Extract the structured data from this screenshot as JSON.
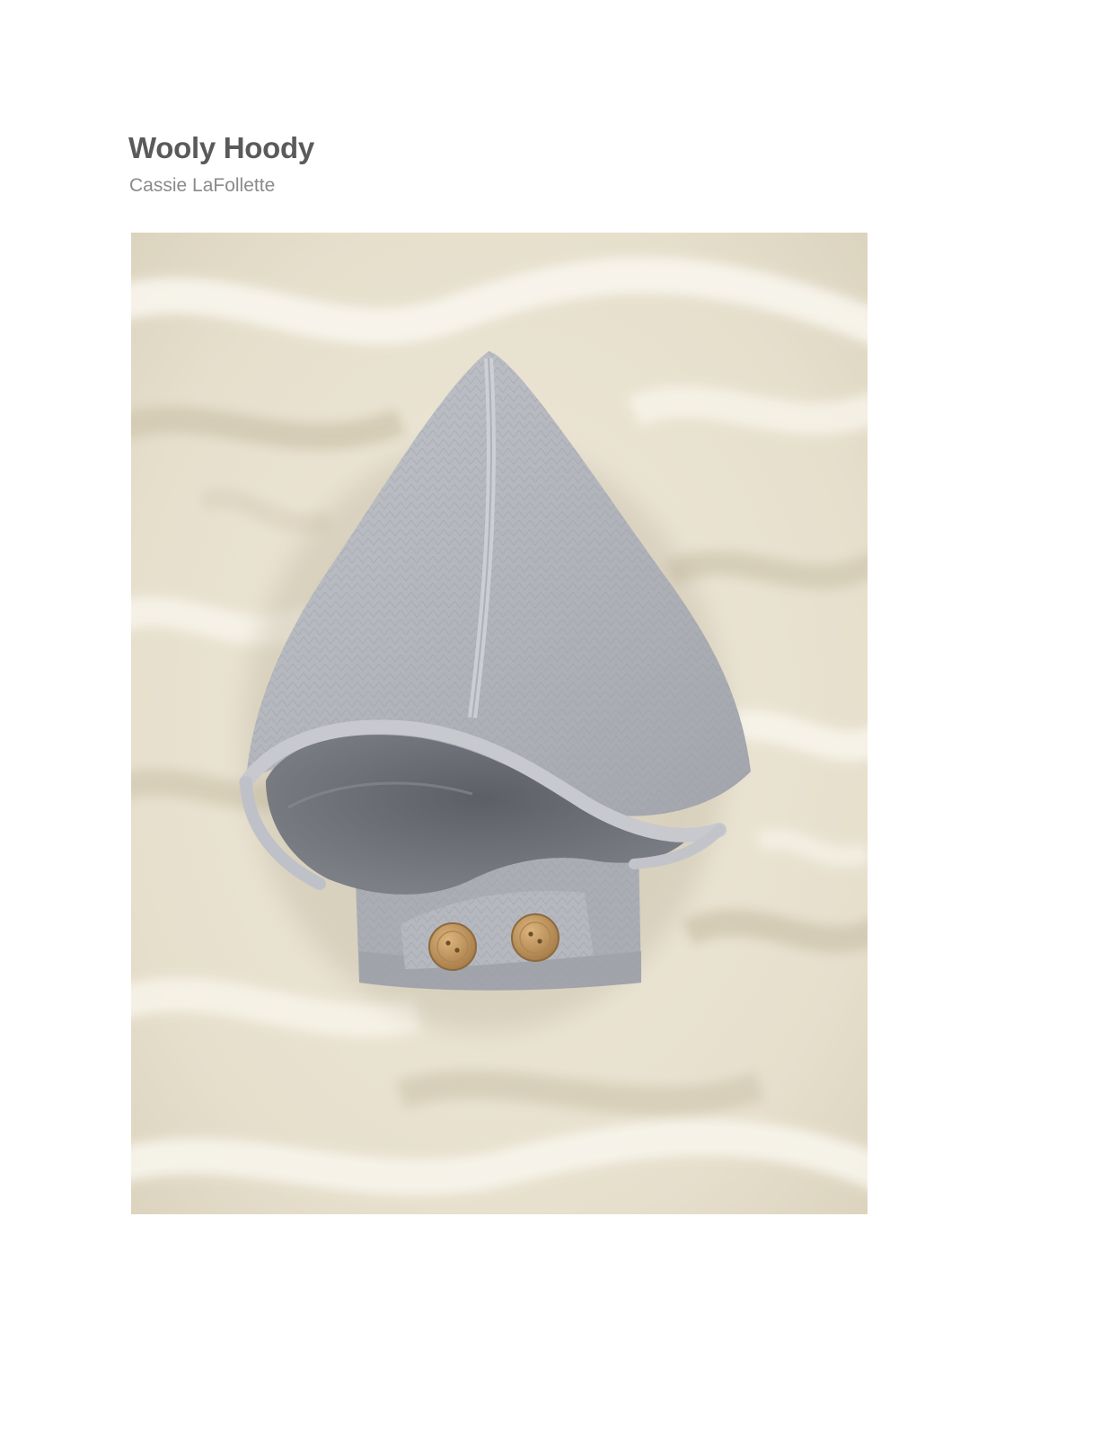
{
  "document": {
    "title": "Wooly Hoody",
    "author": "Cassie LaFollette"
  },
  "photo": {
    "icon": "knitted-hood-photo-icon",
    "colors": {
      "fur": "#ede7d8",
      "fur_shadow": "#d6ceb8",
      "fur_highlight": "#f8f5ec",
      "knit": "#b2b4bb",
      "knit_light": "#c9cbd1",
      "knit_dark": "#8c8e96",
      "hood_inside": "#6f7178",
      "button": "#c49a62",
      "button_dark": "#9c7444"
    }
  }
}
